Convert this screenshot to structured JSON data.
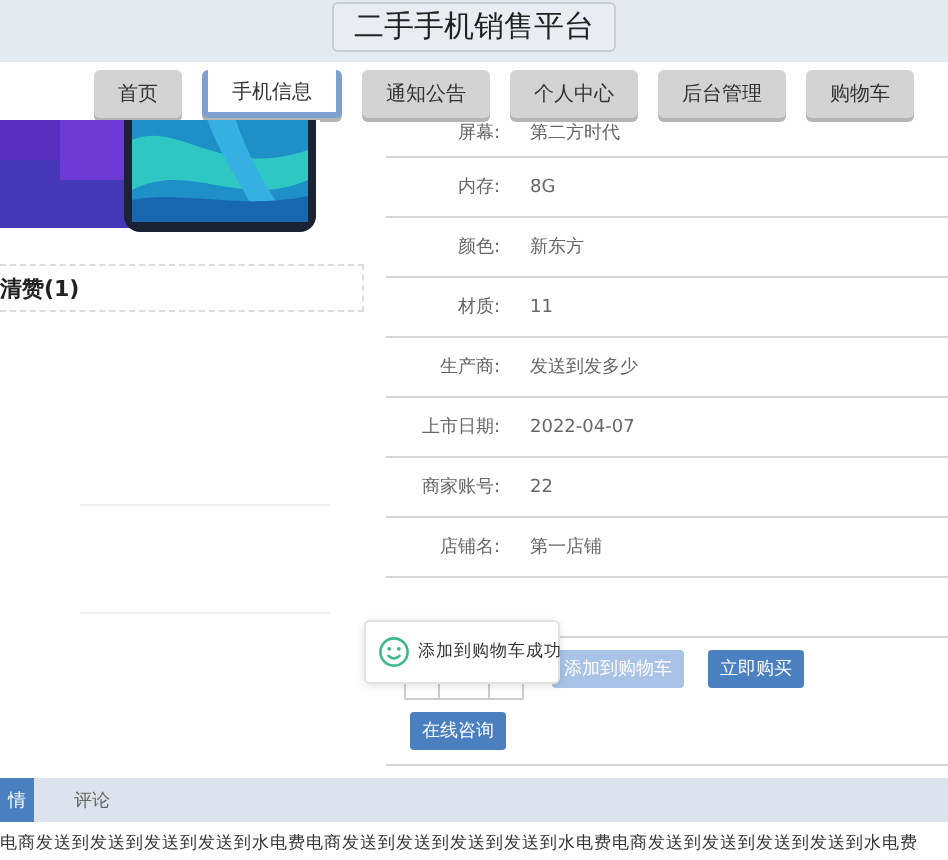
{
  "header": {
    "title": "二手手机销售平台"
  },
  "nav": [
    {
      "label": "首页",
      "selected": false
    },
    {
      "label": "手机信息",
      "selected": true
    },
    {
      "label": "通知公告",
      "selected": false
    },
    {
      "label": "个人中心",
      "selected": false
    },
    {
      "label": "后台管理",
      "selected": false
    },
    {
      "label": "购物车",
      "selected": false
    }
  ],
  "product": {
    "likes": "清赞(1)"
  },
  "details": [
    {
      "label": "屏幕:",
      "value": "第二方时代"
    },
    {
      "label": "内存:",
      "value": "8G"
    },
    {
      "label": "颜色:",
      "value": "新东方"
    },
    {
      "label": "材质:",
      "value": "11"
    },
    {
      "label": "生产商:",
      "value": "发送到发多少"
    },
    {
      "label": "上市日期:",
      "value": "2022-04-07"
    },
    {
      "label": "商家账号:",
      "value": "22"
    },
    {
      "label": "店铺名:",
      "value": "第一店铺"
    }
  ],
  "actions": [
    {
      "label": "添加到购物车",
      "disabled": true
    },
    {
      "label": "立即购买",
      "disabled": false
    }
  ],
  "consult_button": "在线咨询",
  "toast": {
    "message": "添加到购物车成功"
  },
  "bottom_tabs": [
    {
      "label": "情",
      "selected": true
    },
    {
      "label": "评论",
      "selected": false
    }
  ],
  "description": "电商发送到发送到发送到发送到水电费电商发送到发送到发送到发送到水电费电商发送到发送到发送到发送到水电费"
}
